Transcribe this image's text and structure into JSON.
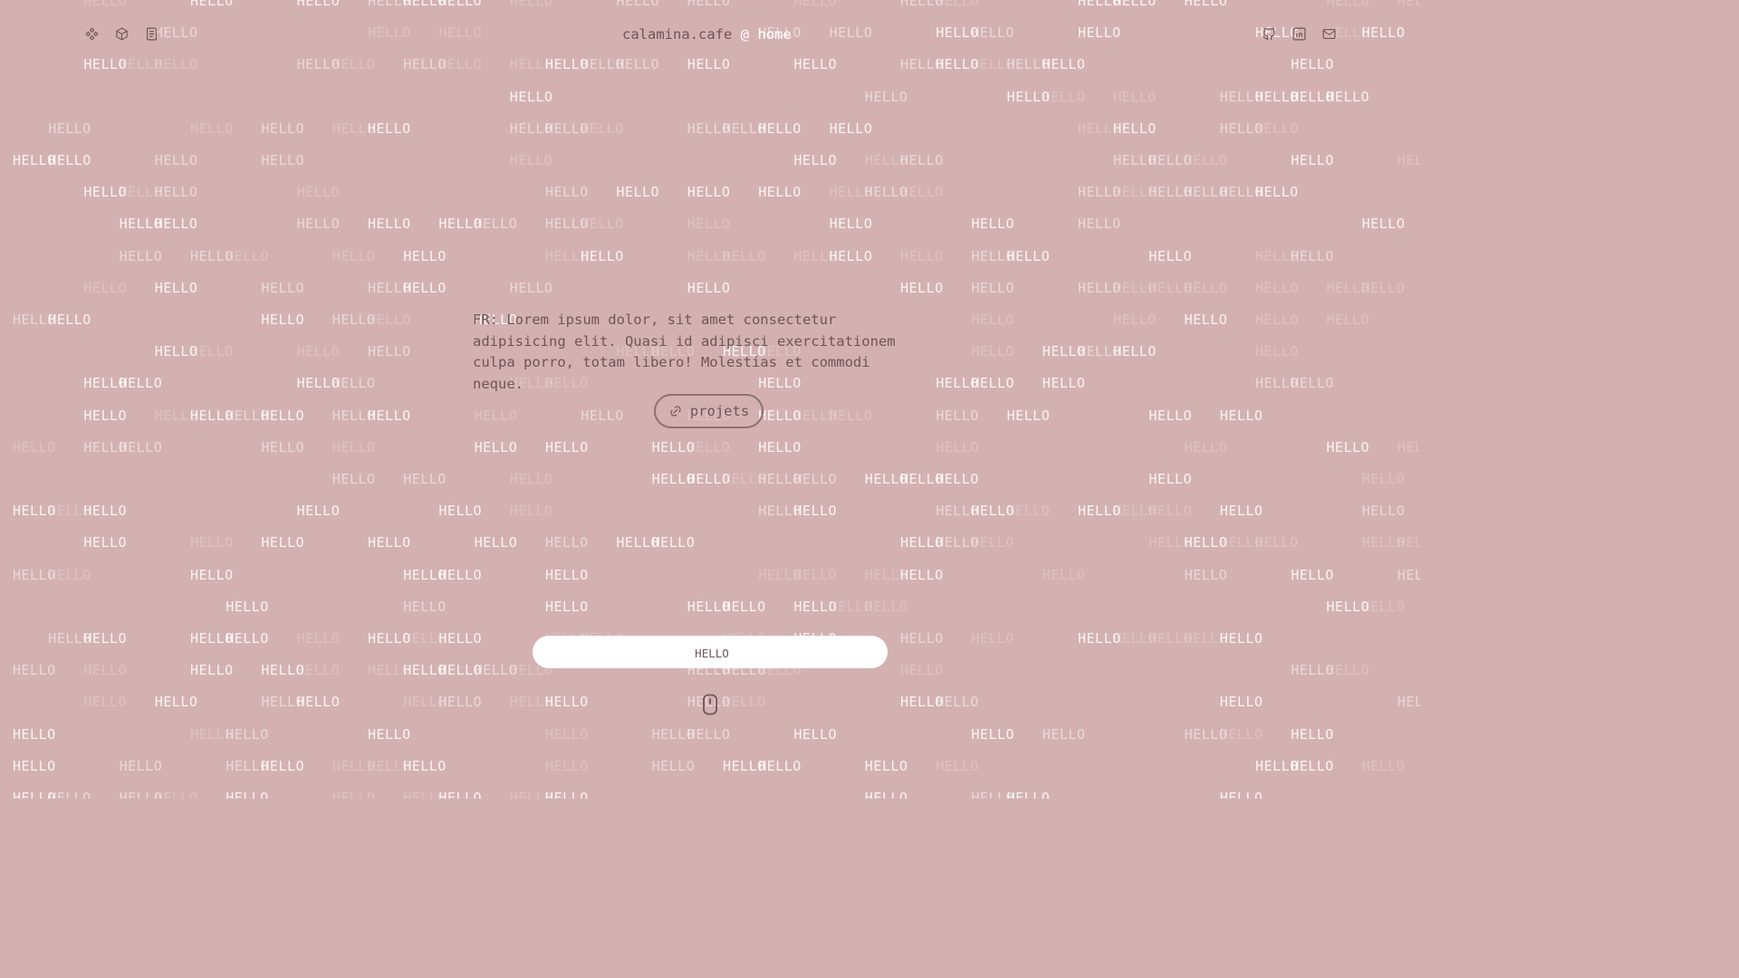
{
  "background": {
    "word": "HELLO",
    "color": "#d4b1b1"
  },
  "header": {
    "left_icons": [
      "apps-icon",
      "cube-icon",
      "document-icon"
    ],
    "brand_site": "calamina.cafe",
    "brand_at": "@",
    "brand_page": "home",
    "right_icons": [
      "github-icon",
      "linkedin-icon",
      "mail-icon"
    ]
  },
  "main": {
    "intro_text": "FR: Lorem ipsum dolor, sit amet consectetur adipisicing elit. Quasi id adipisci exercitationem culpa porro, totam libero! Molestias et commodi neque.",
    "projets_label": "projets",
    "projets_icon": "link-icon"
  },
  "input": {
    "value": "HELLO"
  },
  "scroll_hint": {
    "icon": "mouse-icon"
  }
}
